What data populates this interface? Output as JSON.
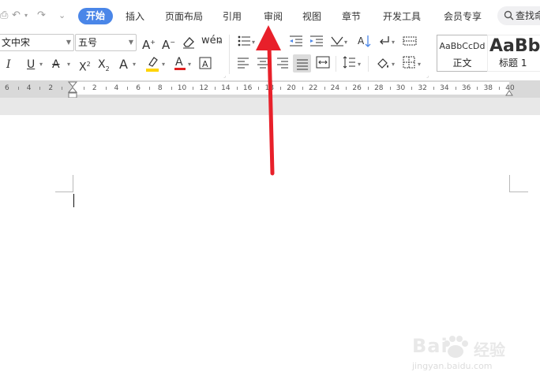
{
  "menu": {
    "tabs": [
      {
        "label": "开始",
        "active": true
      },
      {
        "label": "插入"
      },
      {
        "label": "页面布局"
      },
      {
        "label": "引用"
      },
      {
        "label": "审阅"
      },
      {
        "label": "视图"
      },
      {
        "label": "章节"
      },
      {
        "label": "开发工具"
      },
      {
        "label": "会员专享"
      }
    ],
    "search_label": "查找命"
  },
  "toolbar": {
    "font_name": "文中宋",
    "font_size": "五号",
    "styles": [
      {
        "sample": "AaBbCcDd",
        "name": "正文"
      },
      {
        "sample": "AaBb",
        "name": "标题 1"
      }
    ]
  },
  "ruler": {
    "left_numbers": [
      "6",
      "4",
      "2"
    ],
    "right_numbers": [
      "2",
      "4",
      "6",
      "8",
      "10",
      "12",
      "14",
      "16",
      "18",
      "20",
      "22",
      "24",
      "26",
      "28",
      "30",
      "32",
      "34",
      "36",
      "38",
      "40"
    ]
  },
  "watermark": {
    "logo": "Bai",
    "cn": "经验",
    "url": "jingyan.baidu.com"
  },
  "colors": {
    "accent": "#4a86e8",
    "arrow": "#e8202a",
    "highlight": "#ffd400",
    "font_color": "#e02020"
  }
}
